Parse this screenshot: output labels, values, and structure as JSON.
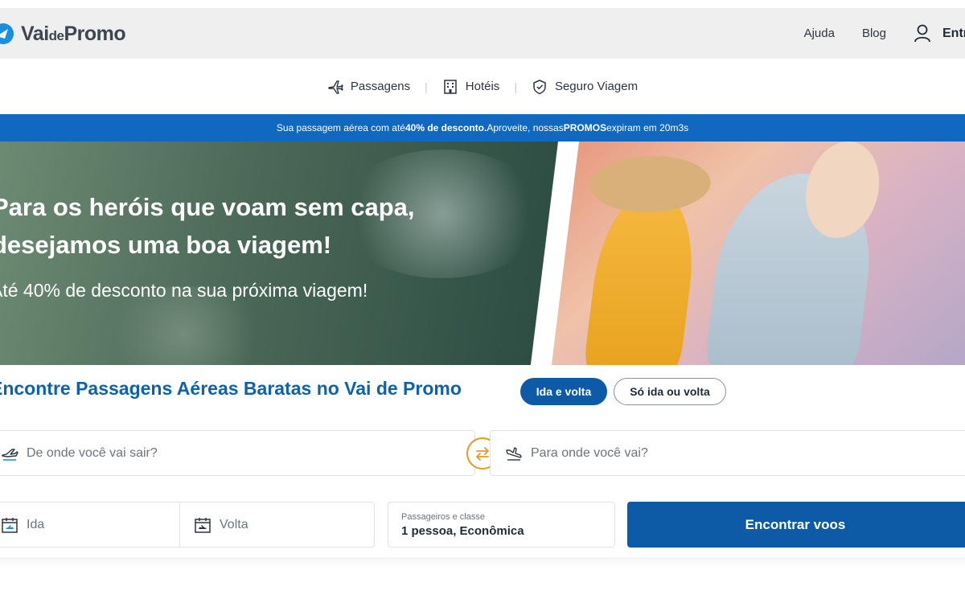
{
  "header": {
    "logo_main": "Vai",
    "logo_small": "de",
    "logo_end": "Promo",
    "nav": [
      "Ajuda",
      "Blog"
    ],
    "login_label": "Entrar"
  },
  "products": [
    {
      "label": "Passagens",
      "icon": "airplane-icon"
    },
    {
      "label": "Hotéis",
      "icon": "hotel-building-icon"
    },
    {
      "label": "Seguro Viagem",
      "icon": "shield-check-icon"
    }
  ],
  "promo_strip": {
    "part1": "Sua passagem aérea com até ",
    "bold1": "40% de desconto.",
    "part2": " Aproveite, nossas ",
    "bold2": "PROMOS",
    "part3": " expiram em 20m3s"
  },
  "hero": {
    "title_line1": "Para os heróis que voam sem capa,",
    "title_line2": "desejamos uma boa viagem!",
    "subtitle": "Até 40% de desconto na sua próxima viagem!"
  },
  "search": {
    "heading": "Encontre Passagens Aéreas Baratas no Vai de Promo",
    "trip_types": [
      "Ida e volta",
      "Só ida ou volta"
    ],
    "origin_placeholder": "De onde você vai sair?",
    "destination_placeholder": "Para onde você vai?",
    "depart_placeholder": "Ida",
    "return_placeholder": "Volta",
    "passengers_label": "Passageiros e classe",
    "passengers_value": "1 pessoa, Econômica",
    "submit_label": "Encontrar voos"
  },
  "colors": {
    "brand_blue": "#0d5aa6",
    "strip_blue": "#1068bf",
    "swap_orange": "#e79a20"
  }
}
